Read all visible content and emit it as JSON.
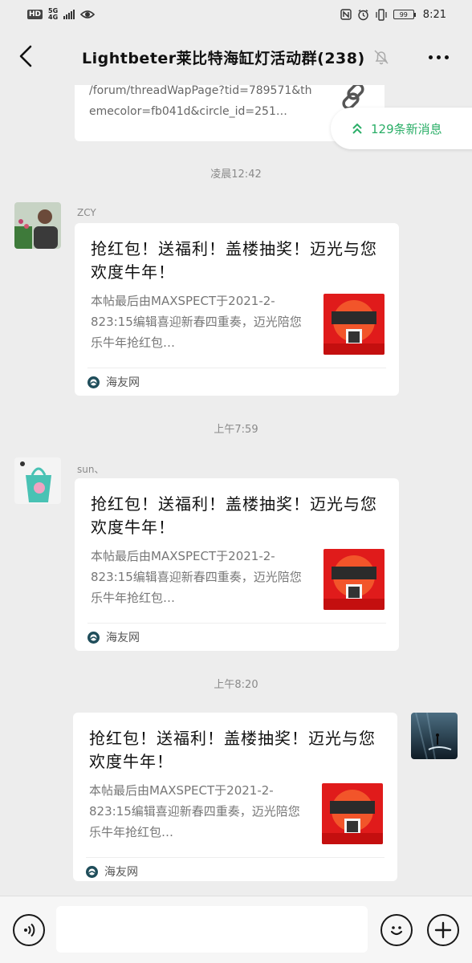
{
  "status_bar": {
    "hd": "HD",
    "network": "5G",
    "network_sub": "4G",
    "battery": "99",
    "time": "8:21"
  },
  "header": {
    "title": "Lightbeter莱比特海缸灯活动群(238)"
  },
  "partial_message": {
    "link_text": "/forum/threadWapPage?tid=789571&themecolor=fb041d&circle_id=251…"
  },
  "new_messages_label": "129条新消息",
  "messages": [
    {
      "timestamp": "凌晨12:42",
      "sender": "ZCY",
      "headline": "抢红包！送福利！盖楼抽奖！迈光与您欢度牛年！",
      "desc": "本帖最后由MAXSPECT于2021-2-823:15编辑喜迎新春四重奏，迈光陪您乐牛年抢红包…",
      "source": "海友网"
    },
    {
      "timestamp": "上午7:59",
      "sender": "sun、",
      "headline": "抢红包！送福利！盖楼抽奖！迈光与您欢度牛年！",
      "desc": "本帖最后由MAXSPECT于2021-2-823:15编辑喜迎新春四重奏，迈光陪您乐牛年抢红包…",
      "source": "海友网"
    },
    {
      "timestamp": "上午8:20",
      "sender": "",
      "headline": "抢红包！送福利！盖楼抽奖！迈光与您欢度牛年！",
      "desc": "本帖最后由MAXSPECT于2021-2-823:15编辑喜迎新春四重奏，迈光陪您乐牛年抢红包…",
      "source": "海友网"
    }
  ],
  "colors": {
    "accent_green": "#2aae67",
    "background": "#ededed"
  }
}
